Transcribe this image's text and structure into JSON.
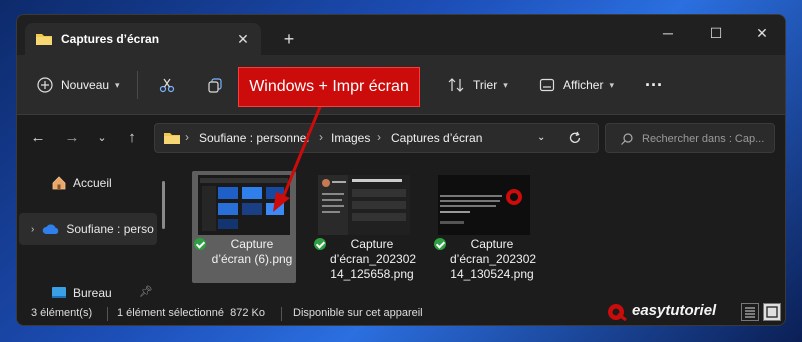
{
  "tab": {
    "title": "Captures d’écran",
    "close": "✕",
    "add": "+"
  },
  "window_controls": {
    "minimize": "─",
    "maximize": "☐",
    "close": "✕"
  },
  "toolbar": {
    "new_label": "Nouveau",
    "sort_label": "Trier",
    "view_label": "Afficher",
    "more_label": "···"
  },
  "breadcrumbs": [
    "Soufiane : personnel",
    "Images",
    "Captures d’écran"
  ],
  "search": {
    "placeholder": "Rechercher dans : Cap..."
  },
  "sidebar": {
    "items": [
      {
        "label": "Accueil"
      },
      {
        "label": "Soufiane : perso"
      },
      {
        "label": "Bureau"
      }
    ]
  },
  "files": [
    {
      "name": "Capture\nd’écran (6).png",
      "selected": true
    },
    {
      "name": "Capture\nd’écran_202302\n14_125658.png",
      "selected": false
    },
    {
      "name": "Capture\nd’écran_202302\n14_130524.png",
      "selected": false
    }
  ],
  "status": {
    "count": "3 élément(s)",
    "selection": "1 élément sélectionné  872 Ko",
    "availability": "Disponible sur cet appareil"
  },
  "callout": {
    "text": "Windows + Impr écran"
  },
  "brand": {
    "text": "easytutoriel"
  },
  "colors": {
    "accent_red": "#cc0b0b",
    "folder_yellow": "#f2c94c",
    "onedrive_blue": "#2f80ed",
    "sync_green": "#2ea043"
  }
}
